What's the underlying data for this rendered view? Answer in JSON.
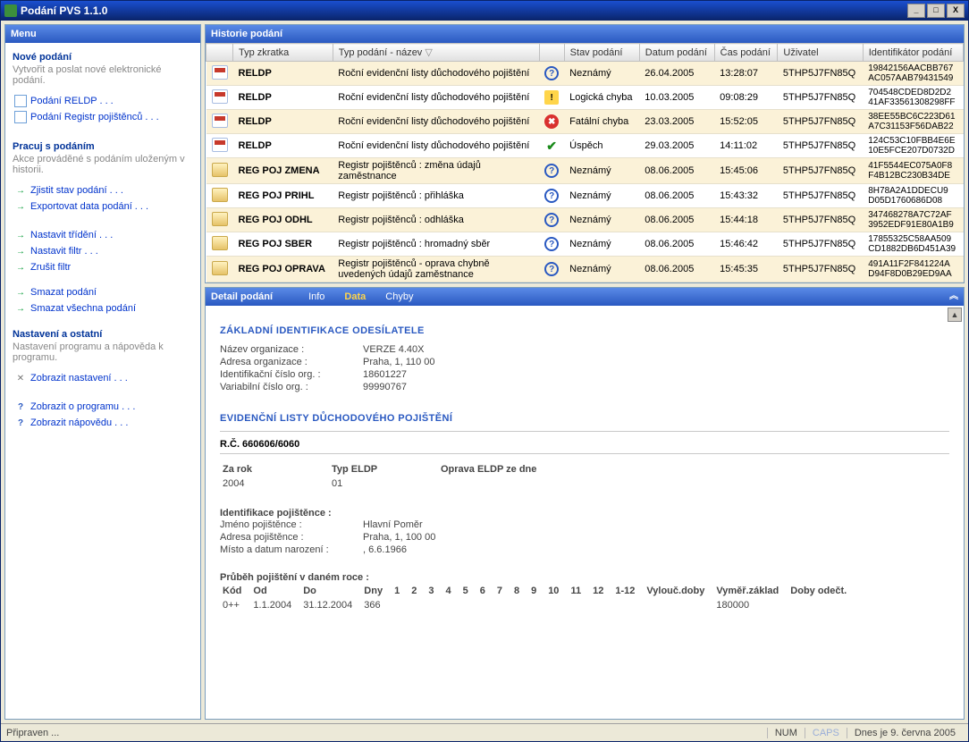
{
  "window": {
    "title": "Podání PVS 1.1.0"
  },
  "sidebar": {
    "header": "Menu",
    "sections": [
      {
        "title": "Nové podání",
        "desc": "Vytvořit a poslat nové elektronické podání.",
        "items": [
          {
            "icon": "page",
            "label": "Podání RELDP . . ."
          },
          {
            "icon": "page",
            "label": "Podání Registr pojištěnců . . ."
          }
        ]
      },
      {
        "title": "Pracuj s podáním",
        "desc": "Akce prováděné s podáním uloženým v historii.",
        "items": [
          {
            "icon": "arrow",
            "label": "Zjistit stav podání . . ."
          },
          {
            "icon": "arrow",
            "label": "Exportovat data podání . . ."
          }
        ]
      },
      {
        "title": "",
        "desc": "",
        "items": [
          {
            "icon": "arrow",
            "label": "Nastavit třídění . . ."
          },
          {
            "icon": "arrow",
            "label": "Nastavit filtr . . ."
          },
          {
            "icon": "arrow",
            "label": "Zrušit filtr"
          }
        ]
      },
      {
        "title": "",
        "desc": "",
        "items": [
          {
            "icon": "arrow",
            "label": "Smazat podání"
          },
          {
            "icon": "arrow",
            "label": "Smazat všechna podání"
          }
        ]
      },
      {
        "title": "Nastavení a ostatní",
        "desc": "Nastavení programu a nápověda k programu.",
        "items": [
          {
            "icon": "tools",
            "label": "Zobrazit nastavení . . ."
          }
        ]
      },
      {
        "title": "",
        "desc": "",
        "items": [
          {
            "icon": "help",
            "label": "Zobrazit o programu . . ."
          },
          {
            "icon": "help",
            "label": "Zobrazit nápovědu . . ."
          }
        ]
      }
    ]
  },
  "history": {
    "header": "Historie podání",
    "columns": [
      "",
      "Typ zkratka",
      "Typ podání - název",
      "",
      "Stav podání",
      "Datum podání",
      "Čas podání",
      "Uživatel",
      "Identifikátor podání"
    ],
    "rows": [
      {
        "iconType": "reldp",
        "typ": "RELDP",
        "nazevTop": "Roční evidenční listy důchodového pojištění",
        "nazevBot": "",
        "status": "unknown",
        "stav": "Neznámý",
        "datum": "26.04.2005",
        "cas": "13:28:07",
        "uzivatel": "5THP5J7FN85Q",
        "idTop": "19842156AACBB767",
        "idBot": "AC057AAB79431549"
      },
      {
        "iconType": "reldp",
        "typ": "RELDP",
        "nazevTop": "Roční evidenční listy důchodového pojištění",
        "nazevBot": "",
        "status": "warn",
        "stav": "Logická chyba",
        "datum": "10.03.2005",
        "cas": "09:08:29",
        "uzivatel": "5THP5J7FN85Q",
        "idTop": "704548CDED8D2D2",
        "idBot": "41AF33561308298FF"
      },
      {
        "iconType": "reldp",
        "typ": "RELDP",
        "nazevTop": "Roční evidenční listy důchodového pojištění",
        "nazevBot": "",
        "status": "error",
        "stav": "Fatální chyba",
        "datum": "23.03.2005",
        "cas": "15:52:05",
        "uzivatel": "5THP5J7FN85Q",
        "idTop": "38EE55BC6C223D61",
        "idBot": "A7C31153F56DAB22"
      },
      {
        "iconType": "reldp",
        "typ": "RELDP",
        "nazevTop": "Roční evidenční listy důchodového pojištění",
        "nazevBot": "",
        "status": "ok",
        "stav": "Úspěch",
        "datum": "29.03.2005",
        "cas": "14:11:02",
        "uzivatel": "5THP5J7FN85Q",
        "idTop": "124C53C10FBB4E6E",
        "idBot": "10E5FCE207D0732D"
      },
      {
        "iconType": "folder",
        "typ": "REG POJ ZMENA",
        "nazevTop": "Registr pojištěnců : změna údajů",
        "nazevBot": "zaměstnance",
        "status": "unknown",
        "stav": "Neznámý",
        "datum": "08.06.2005",
        "cas": "15:45:06",
        "uzivatel": "5THP5J7FN85Q",
        "idTop": "41F5544EC075A0F8",
        "idBot": "F4B12BC230B34DE"
      },
      {
        "iconType": "folder",
        "typ": "REG POJ PRIHL",
        "nazevTop": "Registr pojištěnců : přihláška",
        "nazevBot": "",
        "status": "unknown",
        "stav": "Neznámý",
        "datum": "08.06.2005",
        "cas": "15:43:32",
        "uzivatel": "5THP5J7FN85Q",
        "idTop": "8H78A2A1DDECU9",
        "idBot": "D05D1760686D08"
      },
      {
        "iconType": "folder",
        "typ": "REG POJ ODHL",
        "nazevTop": "Registr pojištěnců : odhláška",
        "nazevBot": "",
        "status": "unknown",
        "stav": "Neznámý",
        "datum": "08.06.2005",
        "cas": "15:44:18",
        "uzivatel": "5THP5J7FN85Q",
        "idTop": "347468278A7C72AF",
        "idBot": "3952EDF91E80A1B9"
      },
      {
        "iconType": "folder",
        "typ": "REG POJ SBER",
        "nazevTop": "Registr pojištěnců : hromadný sběr",
        "nazevBot": "",
        "status": "unknown",
        "stav": "Neznámý",
        "datum": "08.06.2005",
        "cas": "15:46:42",
        "uzivatel": "5THP5J7FN85Q",
        "idTop": "17855325C58AA509",
        "idBot": "CD1882DB6D451A39"
      },
      {
        "iconType": "folder",
        "typ": "REG POJ OPRAVA",
        "nazevTop": "Registr pojištěnců - oprava chybně",
        "nazevBot": "uvedených údajů zaměstnance",
        "status": "unknown",
        "stav": "Neznámý",
        "datum": "08.06.2005",
        "cas": "15:45:35",
        "uzivatel": "5THP5J7FN85Q",
        "idTop": "491A11F2F841224A",
        "idBot": "D94F8D0B29ED9AA"
      }
    ]
  },
  "detail": {
    "header": "Detail podání",
    "tabs": {
      "info": "Info",
      "data": "Data",
      "chyby": "Chyby",
      "active": "data"
    },
    "sect1": "ZÁKLADNÍ IDENTIFIKACE ODESÍLATELE",
    "org": {
      "nazev_k": "Název organizace :",
      "nazev_v": "VERZE 4.40X",
      "adresa_k": "Adresa organizace :",
      "adresa_v": "Praha, 1, 110 00",
      "ico_k": "Identifikační číslo org. :",
      "ico_v": "18601227",
      "var_k": "Variabilní číslo org. :",
      "var_v": "99990767"
    },
    "sect2": "EVIDENČNÍ LISTY DŮCHODOVÉHO POJIŠTĚNÍ",
    "rc_label": "R.Č. 660606/6060",
    "mini": {
      "h1": "Za rok",
      "h2": "Typ ELDP",
      "h3": "Oprava ELDP ze dne",
      "v1": "2004",
      "v2": "01",
      "v3": ""
    },
    "ident_title": "Identifikace pojištěnce :",
    "ident": {
      "jmeno_k": "Jméno pojištěnce :",
      "jmeno_v": "Hlavní Poměr",
      "adresa_k": "Adresa pojištěnce :",
      "adresa_v": "Praha, 1, 100 00",
      "nar_k": "Místo a datum narození :",
      "nar_v": ", 6.6.1966"
    },
    "prubeh_title": "Průběh pojištění v daném roce :",
    "months": {
      "h": [
        "Kód",
        "Od",
        "Do",
        "Dny",
        "1",
        "2",
        "3",
        "4",
        "5",
        "6",
        "7",
        "8",
        "9",
        "10",
        "11",
        "12",
        "1-12",
        "Vylouč.doby",
        "Vyměř.základ",
        "Doby odečt."
      ],
      "r": [
        "0++",
        "1.1.2004",
        "31.12.2004",
        "366",
        "",
        "",
        "",
        "",
        "",
        "",
        "",
        "",
        "",
        "",
        "",
        "",
        "",
        "",
        "180000",
        ""
      ]
    }
  },
  "statusbar": {
    "ready": "Připraven ...",
    "num": "NUM",
    "caps": "CAPS",
    "date": "Dnes je 9. června 2005"
  }
}
